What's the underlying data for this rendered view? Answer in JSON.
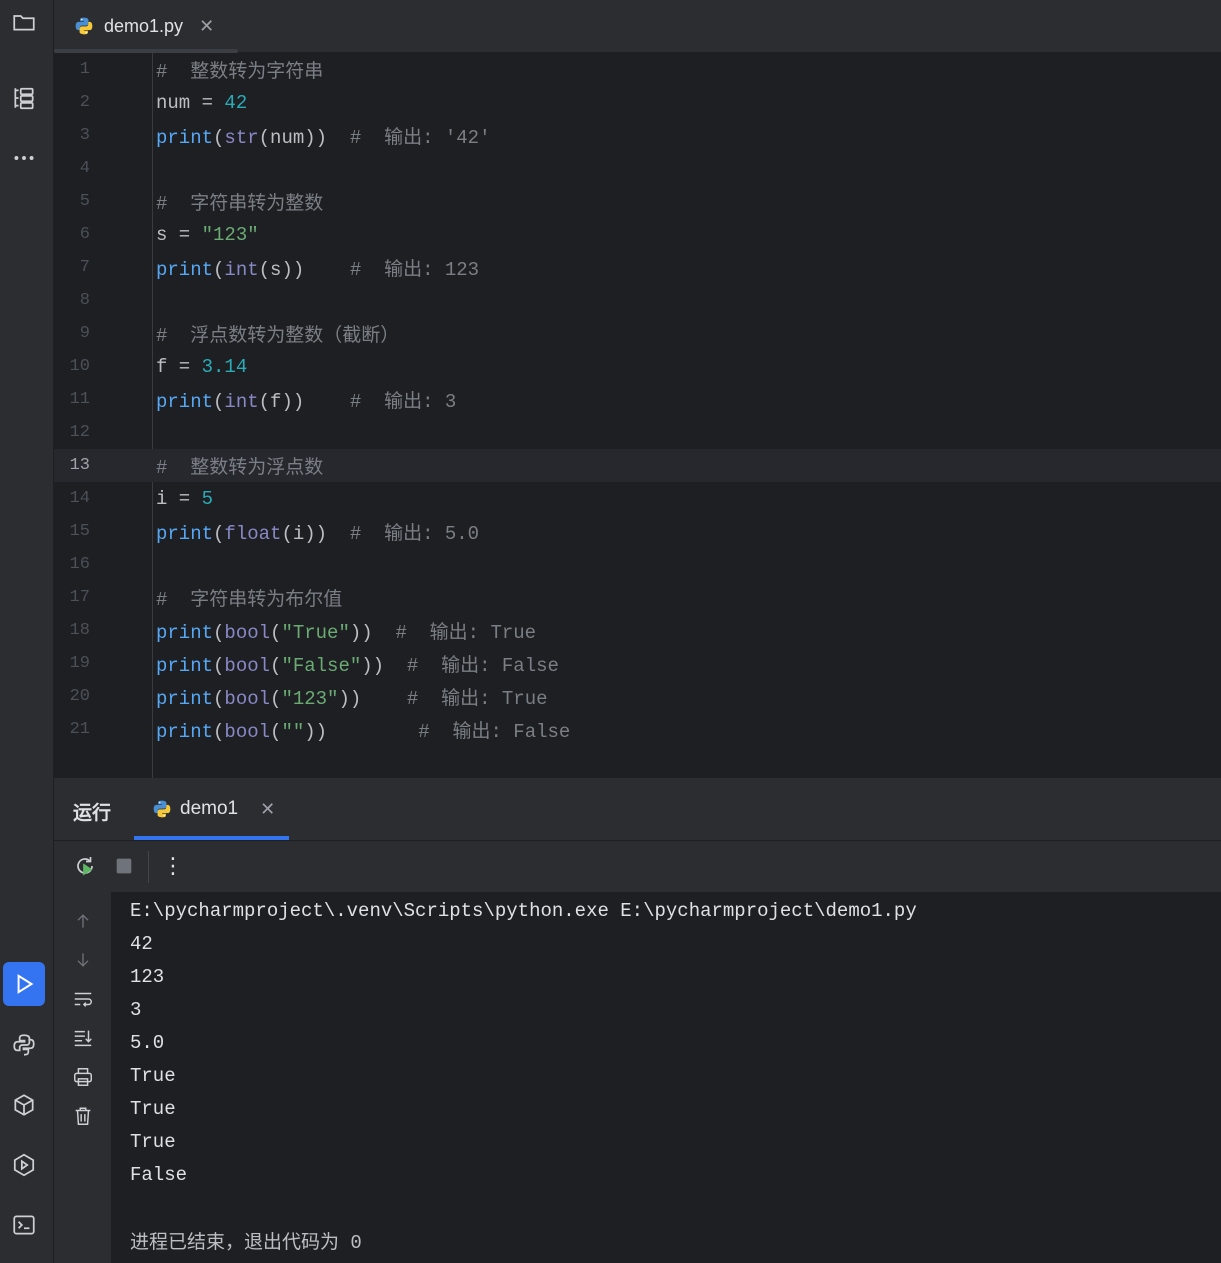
{
  "tab": {
    "filename": "demo1.py",
    "close": "✕"
  },
  "editor": {
    "current_line": 13,
    "lines": [
      {
        "n": "1",
        "tokens": [
          {
            "t": "#  整数转为字符串",
            "c": "cm"
          }
        ]
      },
      {
        "n": "2",
        "tokens": [
          {
            "t": "num = ",
            "c": "pl"
          },
          {
            "t": "42",
            "c": "num"
          }
        ]
      },
      {
        "n": "3",
        "tokens": [
          {
            "t": "print",
            "c": "kw"
          },
          {
            "t": "(",
            "c": "pl"
          },
          {
            "t": "str",
            "c": "fn"
          },
          {
            "t": "(num))  ",
            "c": "pl"
          },
          {
            "t": "#  输出: '42'",
            "c": "cm"
          }
        ]
      },
      {
        "n": "4",
        "tokens": []
      },
      {
        "n": "5",
        "tokens": [
          {
            "t": "#  字符串转为整数",
            "c": "cm"
          }
        ]
      },
      {
        "n": "6",
        "tokens": [
          {
            "t": "s = ",
            "c": "pl"
          },
          {
            "t": "\"123\"",
            "c": "str"
          }
        ]
      },
      {
        "n": "7",
        "tokens": [
          {
            "t": "print",
            "c": "kw"
          },
          {
            "t": "(",
            "c": "pl"
          },
          {
            "t": "int",
            "c": "fn"
          },
          {
            "t": "(s))    ",
            "c": "pl"
          },
          {
            "t": "#  输出: 123",
            "c": "cm"
          }
        ]
      },
      {
        "n": "8",
        "tokens": []
      },
      {
        "n": "9",
        "tokens": [
          {
            "t": "#  浮点数转为整数（截断）",
            "c": "cm"
          }
        ]
      },
      {
        "n": "10",
        "tokens": [
          {
            "t": "f = ",
            "c": "pl"
          },
          {
            "t": "3.14",
            "c": "num"
          }
        ]
      },
      {
        "n": "11",
        "tokens": [
          {
            "t": "print",
            "c": "kw"
          },
          {
            "t": "(",
            "c": "pl"
          },
          {
            "t": "int",
            "c": "fn"
          },
          {
            "t": "(f))    ",
            "c": "pl"
          },
          {
            "t": "#  输出: 3",
            "c": "cm"
          }
        ]
      },
      {
        "n": "12",
        "tokens": []
      },
      {
        "n": "13",
        "tokens": [
          {
            "t": "#  整数转为浮点数",
            "c": "cm"
          }
        ]
      },
      {
        "n": "14",
        "tokens": [
          {
            "t": "i = ",
            "c": "pl"
          },
          {
            "t": "5",
            "c": "num"
          }
        ]
      },
      {
        "n": "15",
        "tokens": [
          {
            "t": "print",
            "c": "kw"
          },
          {
            "t": "(",
            "c": "pl"
          },
          {
            "t": "float",
            "c": "fn"
          },
          {
            "t": "(i))  ",
            "c": "pl"
          },
          {
            "t": "#  输出: 5.0",
            "c": "cm"
          }
        ]
      },
      {
        "n": "16",
        "tokens": []
      },
      {
        "n": "17",
        "tokens": [
          {
            "t": "#  字符串转为布尔值",
            "c": "cm"
          }
        ]
      },
      {
        "n": "18",
        "tokens": [
          {
            "t": "print",
            "c": "kw"
          },
          {
            "t": "(",
            "c": "pl"
          },
          {
            "t": "bool",
            "c": "fn"
          },
          {
            "t": "(",
            "c": "pl"
          },
          {
            "t": "\"True\"",
            "c": "str"
          },
          {
            "t": "))  ",
            "c": "pl"
          },
          {
            "t": "#  输出: True",
            "c": "cm"
          }
        ]
      },
      {
        "n": "19",
        "tokens": [
          {
            "t": "print",
            "c": "kw"
          },
          {
            "t": "(",
            "c": "pl"
          },
          {
            "t": "bool",
            "c": "fn"
          },
          {
            "t": "(",
            "c": "pl"
          },
          {
            "t": "\"False\"",
            "c": "str"
          },
          {
            "t": "))  ",
            "c": "pl"
          },
          {
            "t": "#  输出: False",
            "c": "cm"
          }
        ]
      },
      {
        "n": "20",
        "tokens": [
          {
            "t": "print",
            "c": "kw"
          },
          {
            "t": "(",
            "c": "pl"
          },
          {
            "t": "bool",
            "c": "fn"
          },
          {
            "t": "(",
            "c": "pl"
          },
          {
            "t": "\"123\"",
            "c": "str"
          },
          {
            "t": "))    ",
            "c": "pl"
          },
          {
            "t": "#  输出: True",
            "c": "cm"
          }
        ]
      },
      {
        "n": "21",
        "tokens": [
          {
            "t": "print",
            "c": "kw"
          },
          {
            "t": "(",
            "c": "pl"
          },
          {
            "t": "bool",
            "c": "fn"
          },
          {
            "t": "(",
            "c": "pl"
          },
          {
            "t": "\"\"",
            "c": "str"
          },
          {
            "t": "))        ",
            "c": "pl"
          },
          {
            "t": "#  输出: False",
            "c": "cm"
          }
        ]
      }
    ]
  },
  "run": {
    "label": "运行",
    "tab_name": "demo1",
    "close": "✕",
    "more": "⋮",
    "output": [
      "E:\\pycharmproject\\.venv\\Scripts\\python.exe E:\\pycharmproject\\demo1.py",
      "42",
      "123",
      "3",
      "5.0",
      "True",
      "True",
      "True",
      "False",
      "",
      "进程已结束，退出代码为 0"
    ]
  },
  "colors": {
    "accent": "#3574f0",
    "keyword": "#56a8f5",
    "builtin": "#8888c6",
    "number": "#2aacb8",
    "string": "#6aab73",
    "comment": "#7a7e85"
  }
}
